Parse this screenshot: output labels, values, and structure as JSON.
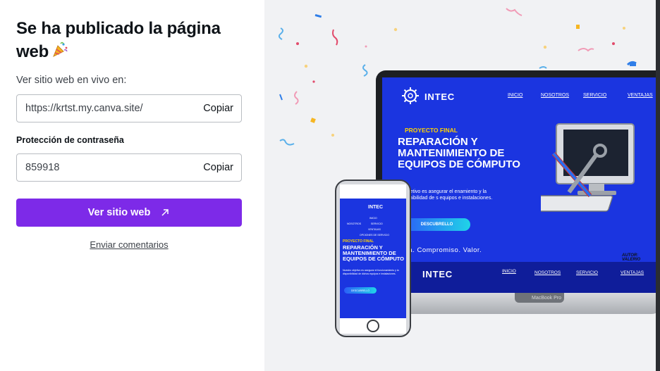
{
  "publish": {
    "title": "Se ha publicado la página web",
    "title_emoji": "party-popper-icon",
    "live_label": "Ver sitio web en vivo en:",
    "url_value": "https://krtst.my.canva.site/",
    "copy_url_label": "Copiar",
    "password_label": "Protección de contraseña",
    "password_value": "859918",
    "copy_password_label": "Copiar",
    "view_button_label": "Ver sitio web",
    "feedback_link": "Enviar comentarios",
    "accent_color": "#7d2ae8"
  },
  "preview": {
    "logo": "INTEC",
    "nav": [
      "INICIO",
      "NOSOTROS",
      "SERVICIO",
      "VENTAJAS"
    ],
    "kicker": "PROYECTO FINAL",
    "headline": "REPARACIÓN Y MANTENIMIENTO DE EQUIPOS DE CÓMPUTO",
    "body": "ro objetivo es asegurar el enamiento y la disponibilidad de s equipos e instalaciones.",
    "cta": "DESCUBRELLO",
    "tagline": "encia. Compromiso. Valor.",
    "signature": "AUTOR: VALERIO",
    "laptop_brand": "MacBook Pro",
    "phone_headline": "REPARACIÓN Y MANTENIMIENTO DE EQUIPOS DE CÓMPUTO",
    "phone_body": "Nuestro objetivo es asegurar el funcionamiento y la disponibilidad de dichos equipos e instalaciones.",
    "phone_cta": "DESCUBRELLO",
    "phone_nav": [
      "INICIO",
      "NOSOTROS",
      "SERVICIO",
      "VENTAJAS",
      "OPCIONES DE SERVICIO"
    ],
    "screen_color": "#1b35e0"
  }
}
